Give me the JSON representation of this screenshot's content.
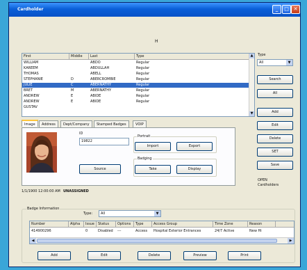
{
  "window": {
    "title": "Cardholder",
    "heading": "H"
  },
  "type_filter": {
    "label": "Type",
    "value": "All"
  },
  "list": {
    "headers": [
      "First",
      "Middle",
      "Last",
      "Type"
    ],
    "rows": [
      {
        "first": "WILLIAM",
        "middle": "",
        "last": "ABDO",
        "type": "Regular"
      },
      {
        "first": "KAREEM",
        "middle": "",
        "last": "ABDULLAH",
        "type": "Regular"
      },
      {
        "first": "THOMAS",
        "middle": "",
        "last": "ABELL",
        "type": "Regular"
      },
      {
        "first": "STEPHANIE",
        "middle": "D",
        "last": "ABERCROMBIE",
        "type": "Regular"
      },
      {
        "first": "JULIE",
        "middle": "C",
        "last": "ABERNATHY",
        "type": "Regular"
      },
      {
        "first": "BRET",
        "middle": "M",
        "last": "ABERNATHY",
        "type": "Regular"
      },
      {
        "first": "ANDREW",
        "middle": "E",
        "last": "ABIDE",
        "type": "Regular"
      },
      {
        "first": "ANDREW",
        "middle": "E",
        "last": "ABIDE",
        "type": "Regular"
      },
      {
        "first": "GUSTAV",
        "middle": "",
        "last": "",
        "type": ""
      }
    ],
    "selected_index": 4
  },
  "right_buttons": [
    "Search",
    "All",
    "Add",
    "Edit",
    "Delete",
    "SET",
    "Save"
  ],
  "tabs": [
    "Image",
    "Address",
    "Dept/Company",
    "Stamped Badges",
    "VOIP"
  ],
  "image_tab": {
    "id_label": "ID",
    "id_value": "19822",
    "portrait_group": "Portrait",
    "import": "Import",
    "export": "Export",
    "badging_group": "Badging",
    "take": "Take",
    "display": "Display",
    "source": "Source"
  },
  "status_line": "1/1/1900 12:00:00 AM",
  "status_value": "UNASSIGNED",
  "right_note": [
    "OPEN",
    "Cardholders"
  ],
  "badge": {
    "group_label": "Badge Information",
    "type_label": "Type:",
    "type_value": "All",
    "headers": [
      "Number",
      "Alpha",
      "Issue",
      "Status",
      "Options",
      "Type",
      "Access Group",
      "Time Zone",
      "Reason"
    ],
    "row": [
      "414900296",
      "",
      "0",
      "Disabled",
      "---",
      "Access",
      "Hospital Exterior Entrances",
      "24/7 Active",
      "New Hi"
    ],
    "buttons": [
      "Add",
      "Edit",
      "Delete",
      "Preview",
      "Print"
    ]
  }
}
